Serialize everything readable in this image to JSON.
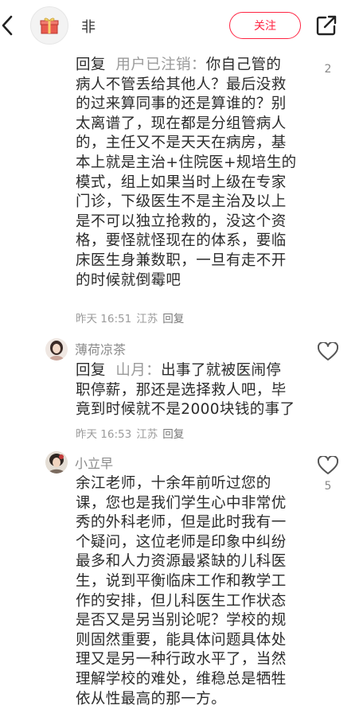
{
  "header": {
    "title": "非",
    "follow_label": "关注"
  },
  "comments": [
    {
      "reply_label": "回复",
      "reply_to": "用户已注销：",
      "lines": [
        "你自己管的",
        "病人不管丢给其他人？最后没救",
        "的过来算同事的还是算谁的？别",
        "太离谱了，现在都是分组管病人",
        "的，主任又不是天天在病房，基",
        "本上就是主治+住院医+规培生的",
        "模式，组上如果当时上级在专家",
        "门诊，下级医生不是主治及以上",
        "是不可以独立抢救的，没这个资",
        "格，要怪就怪现在的体系，要临",
        "床医生身兼数职，一旦有走不开",
        "的时候就倒霉吧"
      ],
      "time": "昨天 16:51",
      "location": "江苏",
      "reply_btn": "回复",
      "likes": "2"
    },
    {
      "username": "薄荷凉茶",
      "reply_label": "回复",
      "reply_to": "山月：",
      "lines": [
        "出事了就被医闹停",
        "职停薪，那还是选择救人吧，毕",
        "竟到时候就不是2000块钱的事了"
      ],
      "time": "昨天 16:53",
      "location": "江苏",
      "reply_btn": "回复"
    },
    {
      "username": "小立早",
      "lines": [
        "余江老师，十余年前听过您的",
        "课，您也是我们学生心中非常优",
        "秀的外科老师，但是此时我有一",
        "个疑问，这位老师是印象中纠纷",
        "最多和人力资源最紧缺的儿科医",
        "生，说到平衡临床工作和教学工",
        "作的安排，但儿科医生工作状态",
        "是否又是另当别论呢？学校的规",
        "则固然重要，能具体问题具体处",
        "理又是另一种行政水平了，当然",
        "理解学校的难处，维稳总是牺牲",
        "依从性最高的那一方。"
      ],
      "likes": "5"
    }
  ],
  "colors": {
    "accent": "#ff2442",
    "secondary_text": "#9b9b9b",
    "primary_text": "#2b2b2b"
  },
  "icons": [
    "back-arrow-icon",
    "gift-icon",
    "share-icon",
    "heart-icon"
  ]
}
